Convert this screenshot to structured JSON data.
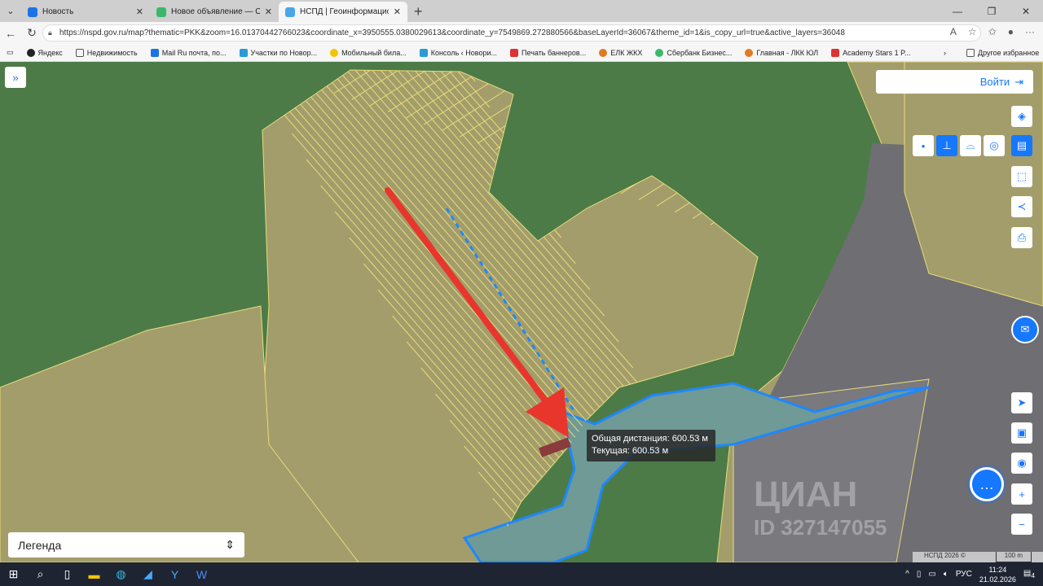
{
  "browser": {
    "tabs": [
      {
        "title": "Новость",
        "active": false
      },
      {
        "title": "Новое объявление — Объявлени",
        "active": false
      },
      {
        "title": "НСПД | Геоинформационный пор",
        "active": true
      }
    ],
    "url": "https://nspd.gov.ru/map?thematic=PKK&zoom=16.01370442766023&coordinate_x=3950555.0380029613&coordinate_y=7549869.272880566&baseLayerId=36067&theme_id=1&is_copy_url=true&active_layers=36048",
    "bookmarks": [
      "Яндекс",
      "Недвижимость",
      "Mail Ru  почта, по...",
      "Участки по Новор...",
      "Мобильный била...",
      "Консоль ‹ Новори...",
      "Печать баннеров...",
      "ЕЛК ЖКХ",
      "Сбербанк Бизнес...",
      "Главная - ЛКК ЮЛ",
      "Academy Stars 1 P..."
    ],
    "other_bookmarks": "Другое избранное"
  },
  "map": {
    "login_label": "Войти",
    "measure_total": "Общая дистанция: 600.53 м",
    "measure_current": "Текущая: 600.53 м",
    "legend_label": "Легенда",
    "watermark": "ЦИАН",
    "watermark_id": "ID 327147055",
    "copyright": "НСПД 2026 ©",
    "scale": "100 m",
    "colors": {
      "forest": "#4c7b48",
      "parcel": "#a39d6b",
      "road": "#6f6e73",
      "water": "#6f9a95",
      "accent": "#1677ff",
      "arrow": "#e8362d"
    }
  },
  "taskbar": {
    "lang": "РУС",
    "time": "11:24",
    "date": "21.02.2026",
    "notifications": "4"
  }
}
